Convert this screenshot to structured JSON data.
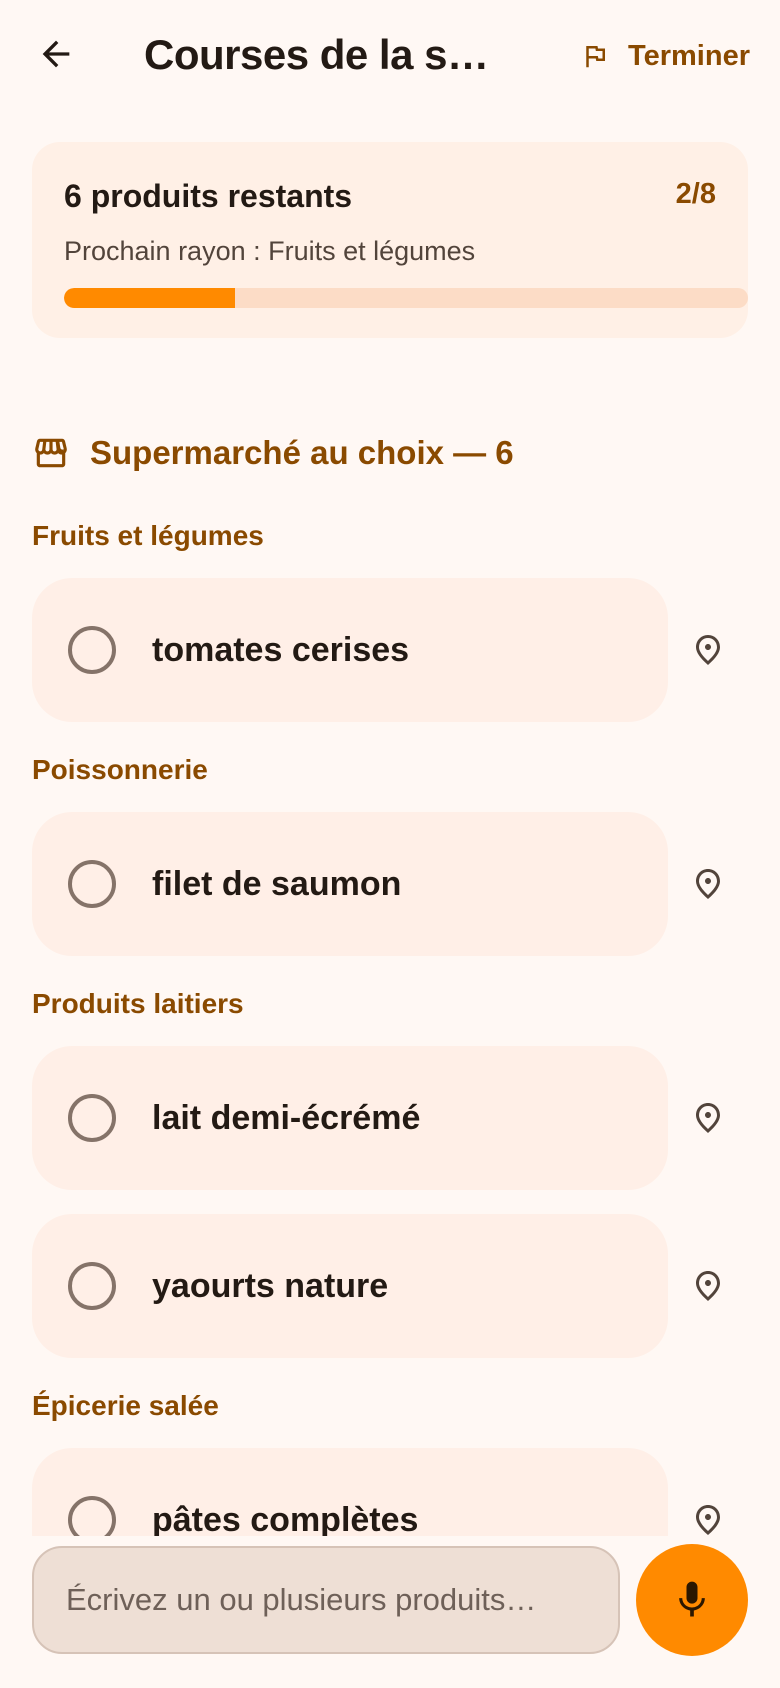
{
  "header": {
    "title": "Courses de la se…",
    "finish_label": "Terminer",
    "back_icon": "arrow-back-icon",
    "finish_icon": "flag-icon"
  },
  "progress": {
    "remaining_label": "6 produits restants",
    "ratio": "2/8",
    "done": 2,
    "total": 8,
    "next_aisle": "Prochain rayon : Fruits et légumes"
  },
  "store": {
    "label": "Supermarché au choix — 6",
    "icon": "store-icon"
  },
  "aisles": [
    {
      "label": "Fruits et légumes",
      "items": [
        {
          "name": "tomates cerises"
        }
      ]
    },
    {
      "label": "Poissonnerie",
      "items": [
        {
          "name": "filet de saumon"
        }
      ]
    },
    {
      "label": "Produits laitiers",
      "items": [
        {
          "name": "lait demi-écrémé"
        },
        {
          "name": "yaourts nature"
        }
      ]
    },
    {
      "label": "Épicerie salée",
      "items": [
        {
          "name": "pâtes complètes"
        }
      ]
    }
  ],
  "input": {
    "placeholder": "Écrivez un ou plusieurs produits…",
    "value": ""
  },
  "colors": {
    "accent": "#FF8A00",
    "accent_dark": "#8A4A00",
    "background": "#FFF8F4",
    "card": "#FFEFE7"
  }
}
